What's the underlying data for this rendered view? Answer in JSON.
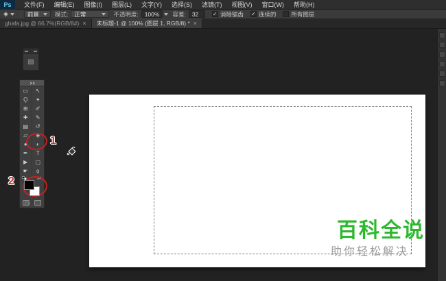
{
  "app": {
    "logo": "Ps"
  },
  "menu_bar": {
    "items": [
      "文件(F)",
      "编辑(E)",
      "图像(I)",
      "图层(L)",
      "文字(Y)",
      "选择(S)",
      "滤镜(T)",
      "视图(V)",
      "窗口(W)",
      "帮助(H)"
    ]
  },
  "options_bar": {
    "tool_icon": "◈",
    "fill_source_value": "前景",
    "mode_label": "模式:",
    "mode_value": "正常",
    "opacity_label": "不透明度:",
    "opacity_value": "100%",
    "tolerance_label": "容差:",
    "tolerance_value": "32",
    "checkboxes": [
      {
        "label": "消除锯齿",
        "mark": "✓",
        "checked": true
      },
      {
        "label": "连续的",
        "mark": "✓",
        "checked": true
      },
      {
        "label": "所有图层",
        "mark": "",
        "checked": false
      }
    ]
  },
  "tabs": [
    {
      "label": "ghafa.jpg @ 66.7%(RGB/8#)",
      "close": "×",
      "active": false
    },
    {
      "label": "未标题-1 @ 100% (图层 1, RGB/8) *",
      "close": "×",
      "active": true
    }
  ],
  "floating_panel": {
    "icon": "▤"
  },
  "toolbar": {
    "tools": [
      {
        "name": "rectangular-marquee",
        "glyph": "▭"
      },
      {
        "name": "move",
        "glyph": "↖"
      },
      {
        "name": "lasso",
        "glyph": "Ǫ"
      },
      {
        "name": "quick-selection",
        "glyph": "✦"
      },
      {
        "name": "crop",
        "glyph": "⊞"
      },
      {
        "name": "eyedropper",
        "glyph": "✐"
      },
      {
        "name": "spot-healing-brush",
        "glyph": "✚"
      },
      {
        "name": "brush",
        "glyph": "✎"
      },
      {
        "name": "clone-stamp",
        "glyph": "▤"
      },
      {
        "name": "history-brush",
        "glyph": "↺"
      },
      {
        "name": "eraser",
        "glyph": "▱"
      },
      {
        "name": "paint-bucket",
        "glyph": "◈"
      },
      {
        "name": "blur",
        "glyph": "●"
      },
      {
        "name": "dodge",
        "glyph": "◐"
      },
      {
        "name": "pen",
        "glyph": "✒"
      },
      {
        "name": "type",
        "glyph": "T"
      },
      {
        "name": "path-selection",
        "glyph": "▶"
      },
      {
        "name": "rectangle-shape",
        "glyph": "▢"
      },
      {
        "name": "hand",
        "glyph": "☛"
      },
      {
        "name": "zoom",
        "glyph": "ϙ"
      }
    ],
    "foreground_color": "#000000",
    "background_color": "#ffffff"
  },
  "annotations": {
    "step1": "1",
    "step2": "2",
    "circle_color": "#c8201f"
  },
  "watermark": {
    "title": "百科全说",
    "subtitle": "助你轻松解决",
    "title_color": "#2eb82e",
    "subtitle_color": "#9b9b9b"
  }
}
